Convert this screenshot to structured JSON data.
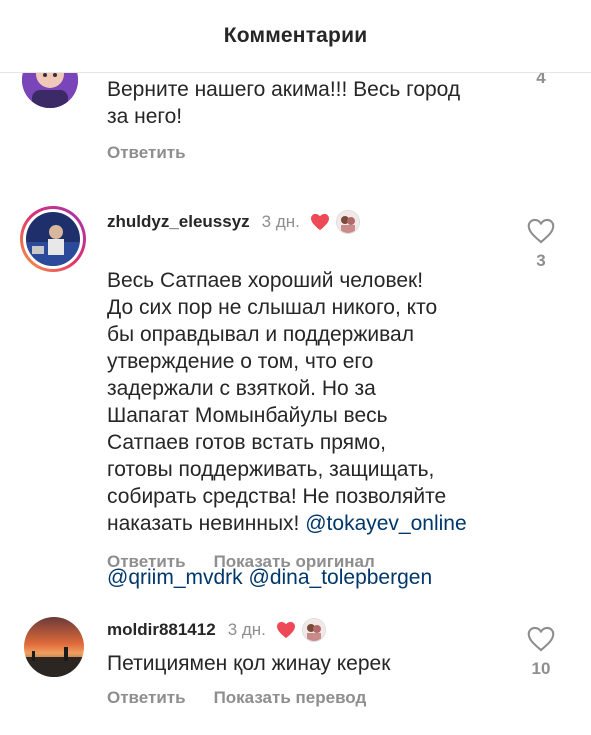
{
  "header": {
    "title": "Комментарии"
  },
  "comments": [
    {
      "text": "Верните нашего акима!!! Весь город\nза него!",
      "reply_label": "Ответить",
      "likes": "4"
    },
    {
      "username": "zhuldyz_eleussyz",
      "time": "3 дн.",
      "text": "Весь Сатпаев хороший человек!\nДо сих пор не слышал никого, кто\nбы оправдывал и поддерживал\nутверждение о том, что его\nзадержали с взяткой. Но за\nШапагат Момынбайулы весь\nСатпаев готов встать прямо,\nготовы поддерживать, защищать,\nсобирать средства! Не позволяйте\nнаказать невинных! ",
      "mention_1": "@tokayev_online",
      "mention_2": "@qriim_mvdrk",
      "mention_3": "@dina_tolepbergen",
      "reply_label": "Ответить",
      "secondary_action": "Показать оригинал",
      "likes": "3"
    },
    {
      "username": "moldir881412",
      "time": "3 дн.",
      "text": "Петициямен қол жинау керек",
      "reply_label": "Ответить",
      "secondary_action": "Показать перевод",
      "likes": "10"
    }
  ],
  "colors": {
    "heart_red": "#ed4956",
    "mention_blue": "#00376b",
    "muted": "#8e8e8e"
  }
}
